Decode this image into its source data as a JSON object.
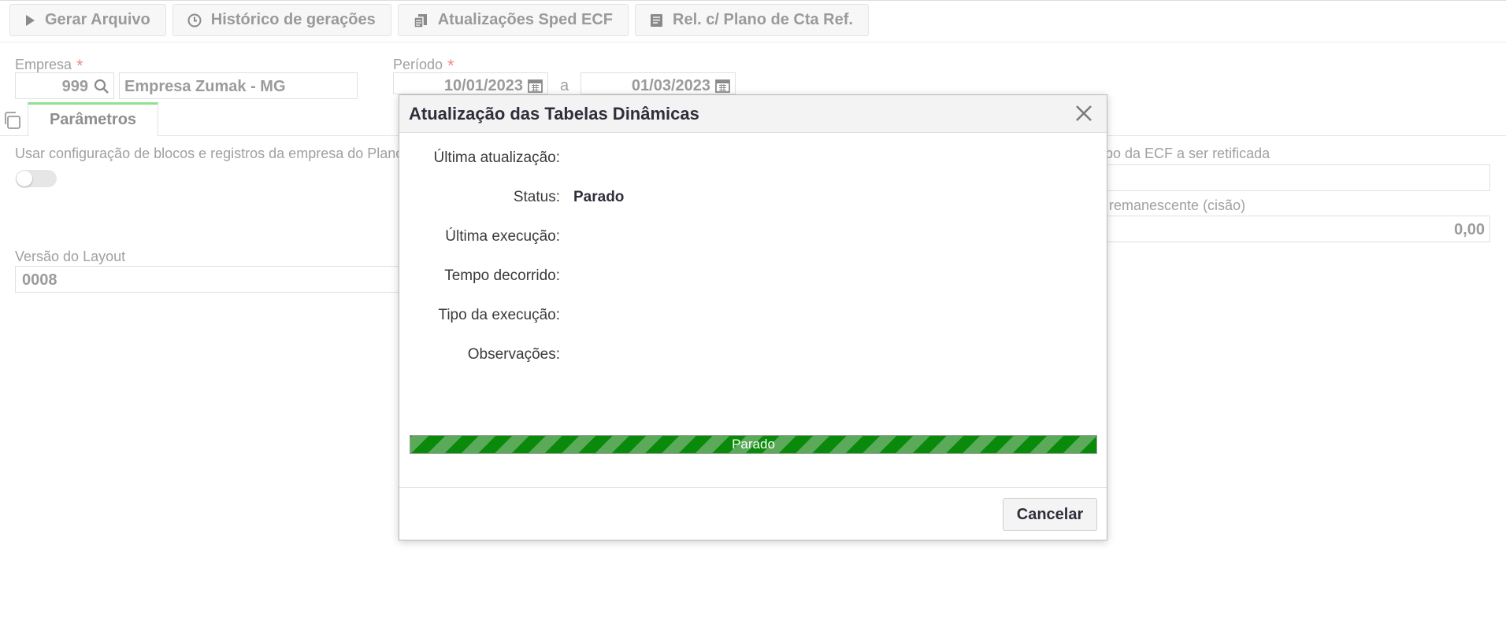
{
  "toolbar": {
    "buttons": [
      {
        "label": "Gerar Arquivo",
        "icon": "play-icon"
      },
      {
        "label": "Histórico de gerações",
        "icon": "clock-icon"
      },
      {
        "label": "Atualizações Sped ECF",
        "icon": "update-documents-icon"
      },
      {
        "label": "Rel. c/ Plano de Cta Ref.",
        "icon": "report-icon"
      }
    ]
  },
  "form": {
    "empresa_label": "Empresa",
    "required_mark": "*",
    "empresa_code": "999",
    "empresa_name": "Empresa Zumak - MG",
    "periodo_label": "Período",
    "periodo_start": "10/01/2023",
    "periodo_sep": "a",
    "periodo_end": "01/03/2023"
  },
  "tabs": {
    "parametros": "Parâmetros"
  },
  "params": {
    "usar_config_label": "Usar configuração de blocos e registros da empresa do Plano",
    "usar_config_on": false,
    "versao_layout_label": "Versão do Layout",
    "versao_layout_value": "0008",
    "recibo_label": "cibo da ECF a ser retificada",
    "remanescente_label": "remanescente (cisão)",
    "remanescente_value": "0,00"
  },
  "modal": {
    "title": "Atualização das Tabelas Dinâmicas",
    "rows": [
      {
        "label": "Última atualização:",
        "value": ""
      },
      {
        "label": "Status:",
        "value": "Parado"
      },
      {
        "label": "Última execução:",
        "value": ""
      },
      {
        "label": "Tempo decorrido:",
        "value": ""
      },
      {
        "label": "Tipo da execução:",
        "value": ""
      },
      {
        "label": "Observações:",
        "value": ""
      }
    ],
    "progress_text": "Parado",
    "progress_fraction": 1.0,
    "cancel_label": "Cancelar"
  },
  "colors": {
    "progress_stripe_dark": "#0a8a0a",
    "progress_stripe_light": "#5aaa5a",
    "required": "#f08a8a",
    "tab_accent": "#8fe08f"
  }
}
